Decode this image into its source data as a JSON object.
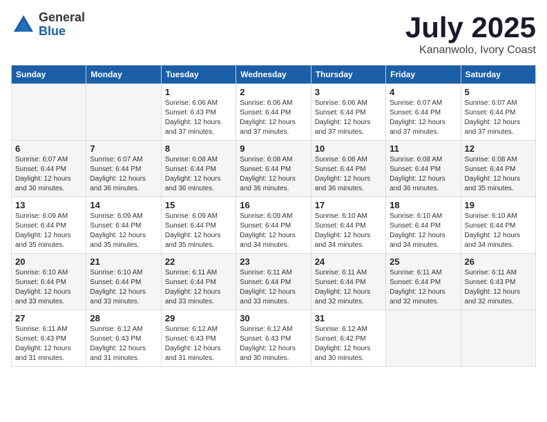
{
  "header": {
    "logo_general": "General",
    "logo_blue": "Blue",
    "month_title": "July 2025",
    "location": "Kananwolo, Ivory Coast"
  },
  "weekdays": [
    "Sunday",
    "Monday",
    "Tuesday",
    "Wednesday",
    "Thursday",
    "Friday",
    "Saturday"
  ],
  "weeks": [
    {
      "days": [
        {
          "num": "",
          "info": ""
        },
        {
          "num": "",
          "info": ""
        },
        {
          "num": "1",
          "info": "Sunrise: 6:06 AM\nSunset: 6:43 PM\nDaylight: 12 hours and 37 minutes."
        },
        {
          "num": "2",
          "info": "Sunrise: 6:06 AM\nSunset: 6:44 PM\nDaylight: 12 hours and 37 minutes."
        },
        {
          "num": "3",
          "info": "Sunrise: 6:06 AM\nSunset: 6:44 PM\nDaylight: 12 hours and 37 minutes."
        },
        {
          "num": "4",
          "info": "Sunrise: 6:07 AM\nSunset: 6:44 PM\nDaylight: 12 hours and 37 minutes."
        },
        {
          "num": "5",
          "info": "Sunrise: 6:07 AM\nSunset: 6:44 PM\nDaylight: 12 hours and 37 minutes."
        }
      ]
    },
    {
      "days": [
        {
          "num": "6",
          "info": "Sunrise: 6:07 AM\nSunset: 6:44 PM\nDaylight: 12 hours and 36 minutes."
        },
        {
          "num": "7",
          "info": "Sunrise: 6:07 AM\nSunset: 6:44 PM\nDaylight: 12 hours and 36 minutes."
        },
        {
          "num": "8",
          "info": "Sunrise: 6:08 AM\nSunset: 6:44 PM\nDaylight: 12 hours and 36 minutes."
        },
        {
          "num": "9",
          "info": "Sunrise: 6:08 AM\nSunset: 6:44 PM\nDaylight: 12 hours and 36 minutes."
        },
        {
          "num": "10",
          "info": "Sunrise: 6:08 AM\nSunset: 6:44 PM\nDaylight: 12 hours and 36 minutes."
        },
        {
          "num": "11",
          "info": "Sunrise: 6:08 AM\nSunset: 6:44 PM\nDaylight: 12 hours and 36 minutes."
        },
        {
          "num": "12",
          "info": "Sunrise: 6:08 AM\nSunset: 6:44 PM\nDaylight: 12 hours and 35 minutes."
        }
      ]
    },
    {
      "days": [
        {
          "num": "13",
          "info": "Sunrise: 6:09 AM\nSunset: 6:44 PM\nDaylight: 12 hours and 35 minutes."
        },
        {
          "num": "14",
          "info": "Sunrise: 6:09 AM\nSunset: 6:44 PM\nDaylight: 12 hours and 35 minutes."
        },
        {
          "num": "15",
          "info": "Sunrise: 6:09 AM\nSunset: 6:44 PM\nDaylight: 12 hours and 35 minutes."
        },
        {
          "num": "16",
          "info": "Sunrise: 6:09 AM\nSunset: 6:44 PM\nDaylight: 12 hours and 34 minutes."
        },
        {
          "num": "17",
          "info": "Sunrise: 6:10 AM\nSunset: 6:44 PM\nDaylight: 12 hours and 34 minutes."
        },
        {
          "num": "18",
          "info": "Sunrise: 6:10 AM\nSunset: 6:44 PM\nDaylight: 12 hours and 34 minutes."
        },
        {
          "num": "19",
          "info": "Sunrise: 6:10 AM\nSunset: 6:44 PM\nDaylight: 12 hours and 34 minutes."
        }
      ]
    },
    {
      "days": [
        {
          "num": "20",
          "info": "Sunrise: 6:10 AM\nSunset: 6:44 PM\nDaylight: 12 hours and 33 minutes."
        },
        {
          "num": "21",
          "info": "Sunrise: 6:10 AM\nSunset: 6:44 PM\nDaylight: 12 hours and 33 minutes."
        },
        {
          "num": "22",
          "info": "Sunrise: 6:11 AM\nSunset: 6:44 PM\nDaylight: 12 hours and 33 minutes."
        },
        {
          "num": "23",
          "info": "Sunrise: 6:11 AM\nSunset: 6:44 PM\nDaylight: 12 hours and 33 minutes."
        },
        {
          "num": "24",
          "info": "Sunrise: 6:11 AM\nSunset: 6:44 PM\nDaylight: 12 hours and 32 minutes."
        },
        {
          "num": "25",
          "info": "Sunrise: 6:11 AM\nSunset: 6:44 PM\nDaylight: 12 hours and 32 minutes."
        },
        {
          "num": "26",
          "info": "Sunrise: 6:11 AM\nSunset: 6:43 PM\nDaylight: 12 hours and 32 minutes."
        }
      ]
    },
    {
      "days": [
        {
          "num": "27",
          "info": "Sunrise: 6:11 AM\nSunset: 6:43 PM\nDaylight: 12 hours and 31 minutes."
        },
        {
          "num": "28",
          "info": "Sunrise: 6:12 AM\nSunset: 6:43 PM\nDaylight: 12 hours and 31 minutes."
        },
        {
          "num": "29",
          "info": "Sunrise: 6:12 AM\nSunset: 6:43 PM\nDaylight: 12 hours and 31 minutes."
        },
        {
          "num": "30",
          "info": "Sunrise: 6:12 AM\nSunset: 6:43 PM\nDaylight: 12 hours and 30 minutes."
        },
        {
          "num": "31",
          "info": "Sunrise: 6:12 AM\nSunset: 6:42 PM\nDaylight: 12 hours and 30 minutes."
        },
        {
          "num": "",
          "info": ""
        },
        {
          "num": "",
          "info": ""
        }
      ]
    }
  ]
}
